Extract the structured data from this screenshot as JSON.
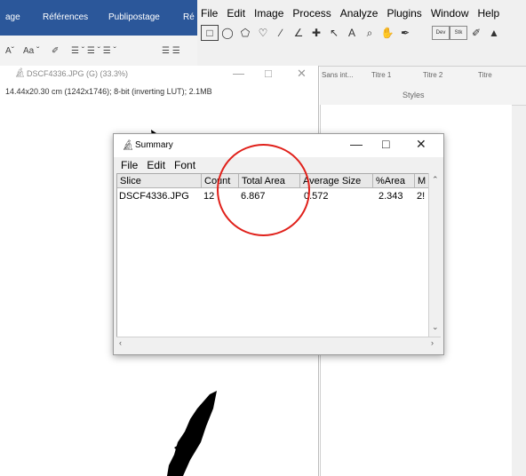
{
  "word": {
    "tabs": [
      "age",
      "Références",
      "Publipostage",
      "Ré"
    ],
    "ribbon_items": [
      "Aˇ",
      "Aa ˇ",
      "☰ ˇ ☰ ˇ ☰ ˇ",
      "☰ ☰"
    ],
    "styles": [
      "Sans int...",
      "Titre 1",
      "Titre 2",
      "Titre"
    ],
    "styles_label": "Styles"
  },
  "imagej": {
    "menu": [
      "File",
      "Edit",
      "Image",
      "Process",
      "Analyze",
      "Plugins",
      "Window",
      "Help"
    ],
    "tool_labels": [
      "Dev",
      "Stk"
    ]
  },
  "image_window": {
    "title": "DSCF4336.JPG (G) (33.3%)",
    "info": "14.44x20.30 cm (1242x1746); 8-bit (inverting LUT); 2.1MB"
  },
  "summary": {
    "title": "Summary",
    "menu": [
      "File",
      "Edit",
      "Font"
    ],
    "columns": [
      "Slice",
      "Count",
      "Total Area",
      "Average Size",
      "%Area",
      "M"
    ],
    "row": [
      "DSCF4336.JPG",
      "12",
      "6.867",
      "0.572",
      "2.343",
      "2!"
    ]
  },
  "colors": {
    "word_blue": "#2b579a",
    "annotation_red": "#e0201a"
  }
}
